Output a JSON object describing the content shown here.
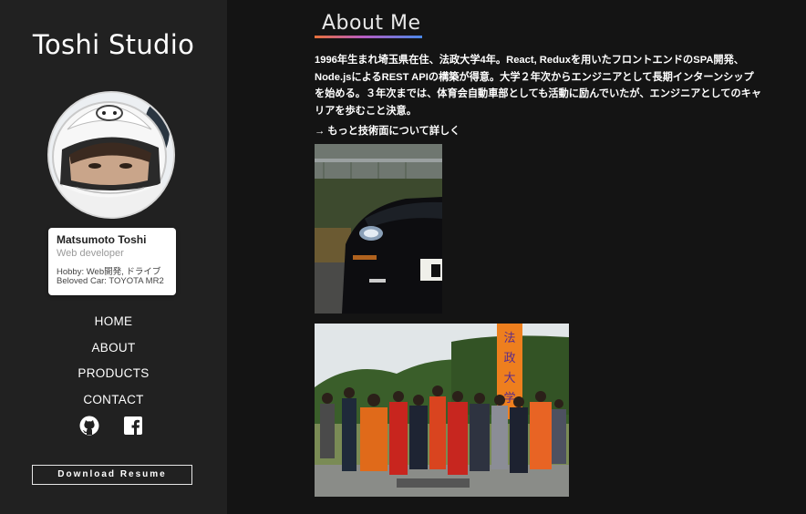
{
  "sidebar": {
    "brand": "Toshi Studio",
    "profile": {
      "name": "Matsumoto Toshi",
      "role": "Web developer",
      "hobby": "Hobby: Web開発, ドライブ",
      "car": "Beloved Car: TOYOTA MR2"
    },
    "nav": [
      {
        "label": "HOME"
      },
      {
        "label": "ABOUT"
      },
      {
        "label": "PRODUCTS"
      },
      {
        "label": "CONTACT"
      }
    ],
    "social": [
      {
        "icon": "github-icon"
      },
      {
        "icon": "facebook-icon"
      }
    ],
    "resume_label": "Download Resume"
  },
  "main": {
    "title": "About Me",
    "bio": "1996年生まれ埼玉県在住、法政大学4年。React, Reduxを用いたフロントエンドのSPA開発、Node.jsによるREST APIの構築が得意。大学２年次からエンジニアとして長期インターンシップを始める。３年次までは、体育会自動車部としても活動に励んでいたが、エンジニアとしてのキャリアを歩むこと決意。",
    "more_link": "→ もっと技術面について詳しく",
    "photo_banner_text": "法政大学"
  },
  "colors": {
    "sidebar_bg": "#212121",
    "page_bg": "#141414",
    "underline_start": "#e8703a",
    "underline_mid": "#b85cc2",
    "underline_end": "#4a88e8"
  }
}
